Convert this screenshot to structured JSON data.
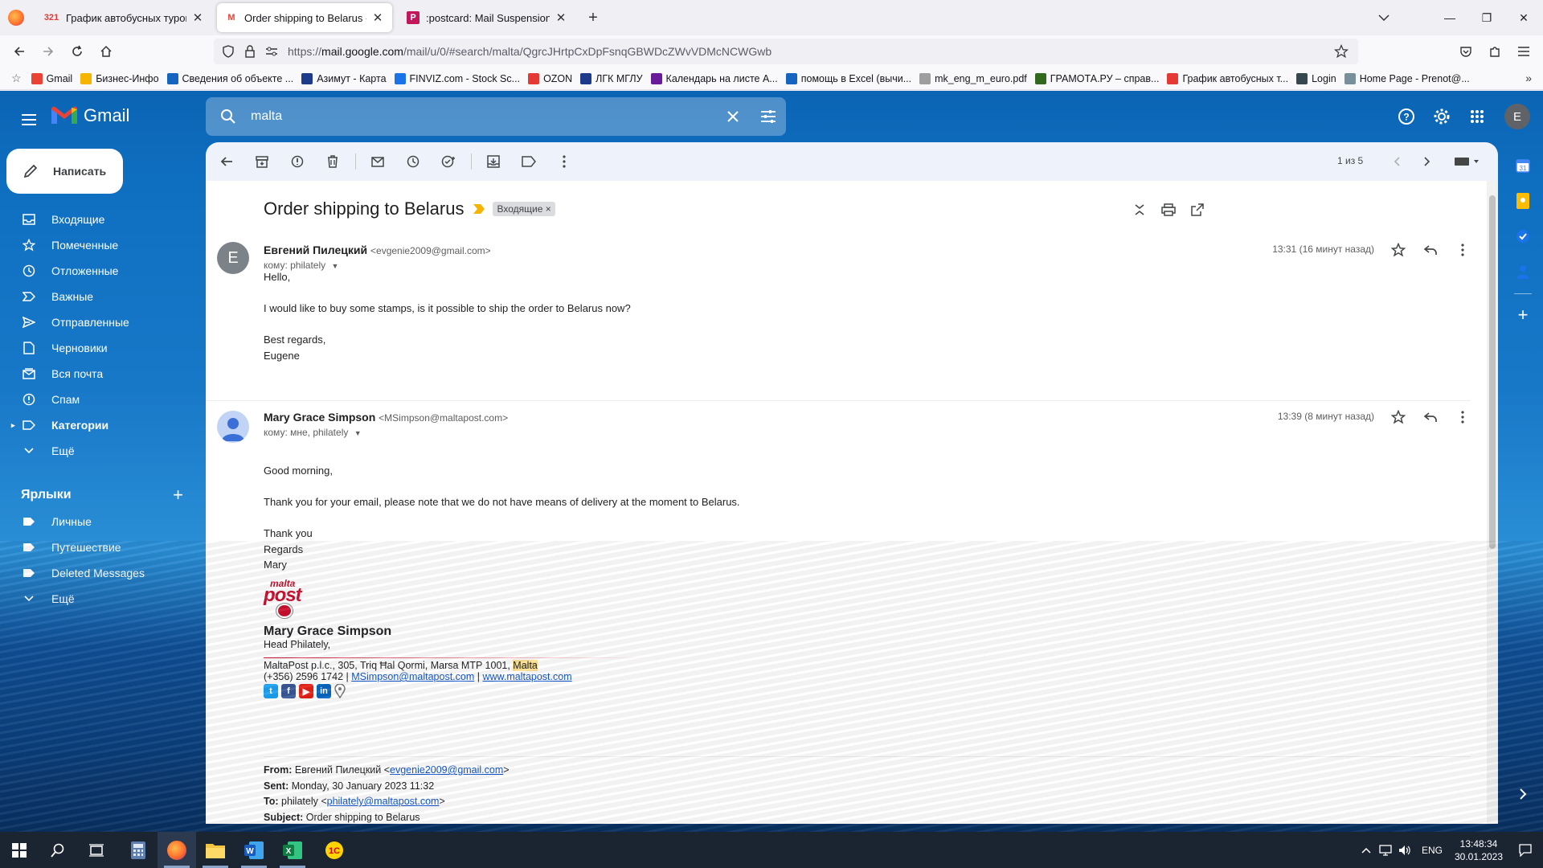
{
  "browser": {
    "tabs": [
      {
        "favicon": "321",
        "title": "График автобусных туров в Е"
      },
      {
        "favicon": "M",
        "title": "Order shipping to Belarus - evg"
      },
      {
        "favicon": "P",
        "title": ":postcard: Mail Suspension Aler"
      }
    ],
    "url_prefix": "https://",
    "url_host": "mail.google.com",
    "url_path": "/mail/u/0/#search/malta/QgrcJHrtpCxDpFsnqGBWDcZWvVDMcNCWGwb",
    "bookmarks": [
      {
        "icon": "gmail-icon",
        "label": "Gmail",
        "color": "#ea4335"
      },
      {
        "icon": "smile-icon",
        "label": "Бизнес-Инфо",
        "color": "#f4b400"
      },
      {
        "icon": "nk-icon",
        "label": "Сведения об объекте ...",
        "color": "#1565c0"
      },
      {
        "icon": "azimut-icon",
        "label": "Азимут - Карта",
        "color": "#1e3a8a"
      },
      {
        "icon": "finviz-icon",
        "label": "FINVIZ.com - Stock Sc...",
        "color": "#1a73e8"
      },
      {
        "icon": "ozon-icon",
        "label": "OZON",
        "color": "#e53935"
      },
      {
        "icon": "lgk-icon",
        "label": "ЛГК МГЛУ",
        "color": "#1e3a8a"
      },
      {
        "icon": "calendar-icon",
        "label": "Календарь на листе А...",
        "color": "#6a1b9a"
      },
      {
        "icon": "excel-help-icon",
        "label": "помощь в Excel (вычи...",
        "color": "#1565c0"
      },
      {
        "icon": "pdf-icon",
        "label": "mk_eng_m_euro.pdf",
        "color": "#9e9e9e"
      },
      {
        "icon": "gramota-icon",
        "label": "ГРАМОТА.РУ – справ...",
        "color": "#33691e"
      },
      {
        "icon": "tour-icon",
        "label": "График автобусных т...",
        "color": "#e53935"
      },
      {
        "icon": "login-icon",
        "label": "Login",
        "color": "#37474f"
      },
      {
        "icon": "page-icon",
        "label": "Home Page - Prenot@...",
        "color": "#78909c"
      }
    ]
  },
  "gmail": {
    "app_name": "Gmail",
    "search_value": "malta",
    "compose_label": "Написать",
    "nav": [
      {
        "icon": "inbox-icon",
        "label": "Входящие",
        "bold": false
      },
      {
        "icon": "star-icon",
        "label": "Помеченные",
        "bold": false
      },
      {
        "icon": "clock-icon",
        "label": "Отложенные",
        "bold": false
      },
      {
        "icon": "important-icon",
        "label": "Важные",
        "bold": false
      },
      {
        "icon": "send-icon",
        "label": "Отправленные",
        "bold": false
      },
      {
        "icon": "draft-icon",
        "label": "Черновики",
        "bold": false
      },
      {
        "icon": "all-mail-icon",
        "label": "Вся почта",
        "bold": false
      },
      {
        "icon": "spam-icon",
        "label": "Спам",
        "bold": false
      },
      {
        "icon": "categories-icon",
        "label": "Категории",
        "bold": true
      },
      {
        "icon": "chevron-down-icon",
        "label": "Ещё",
        "bold": false
      }
    ],
    "labels_title": "Ярлыки",
    "labels": [
      {
        "icon": "label-icon",
        "label": "Личные"
      },
      {
        "icon": "label-icon",
        "label": "Путешествие"
      },
      {
        "icon": "label-icon",
        "label": "Deleted Messages"
      },
      {
        "icon": "chevron-down-icon",
        "label": "Ещё"
      }
    ],
    "pager": "1 из 5",
    "thread": {
      "subject": "Order shipping to Belarus",
      "chip": "Входящие",
      "messages": [
        {
          "avatar": "E",
          "sender": "Евгений Пилецкий",
          "email": "<evgenie2009@gmail.com>",
          "to": "кому: philately",
          "time": "13:31 (16 минут назад)",
          "body": [
            "Hello,",
            "",
            "I would like to buy some stamps, is it possible to ship the order to Belarus now?",
            "",
            "Best regards,",
            "Eugene"
          ]
        },
        {
          "avatar": "",
          "sender": "Mary Grace Simpson",
          "email": "<MSimpson@maltapost.com>",
          "to": "кому: мне, philately",
          "time": "13:39 (8 минут назад)",
          "body": [
            "Good morning,",
            "",
            "Thank you for your email, please note that we do not have means of delivery at the moment to Belarus.",
            "",
            "Thank you",
            "Regards",
            "Mary"
          ]
        }
      ],
      "signature": {
        "logo_top": "malta",
        "logo_bottom": "post",
        "name": "Mary Grace Simpson",
        "title": "Head Philately,",
        "address": "MaltaPost p.l.c., 305, Triq Ħal Qormi, Marsa MTP 1001, ",
        "address_hl": "Malta",
        "phone": "(+356) 2596 1742 | ",
        "email": "MSimpson@maltapost.com",
        "sep": " | ",
        "web": "www.maltapost.com"
      },
      "quoted": {
        "from_label": "From:",
        "from_name": " Евгений Пилецкий <",
        "from_email": "evgenie2009@gmail.com",
        "from_end": ">",
        "sent_label": "Sent:",
        "sent": " Monday, 30 January 2023 11:32",
        "to_label": "To:",
        "to_name": " philately <",
        "to_email": "philately@maltapost.com",
        "to_end": ">",
        "subject_label": "Subject:",
        "subject": " Order shipping to Belarus"
      }
    }
  },
  "taskbar": {
    "lang": "ENG",
    "time": "13:48:34",
    "date": "30.01.2023"
  }
}
